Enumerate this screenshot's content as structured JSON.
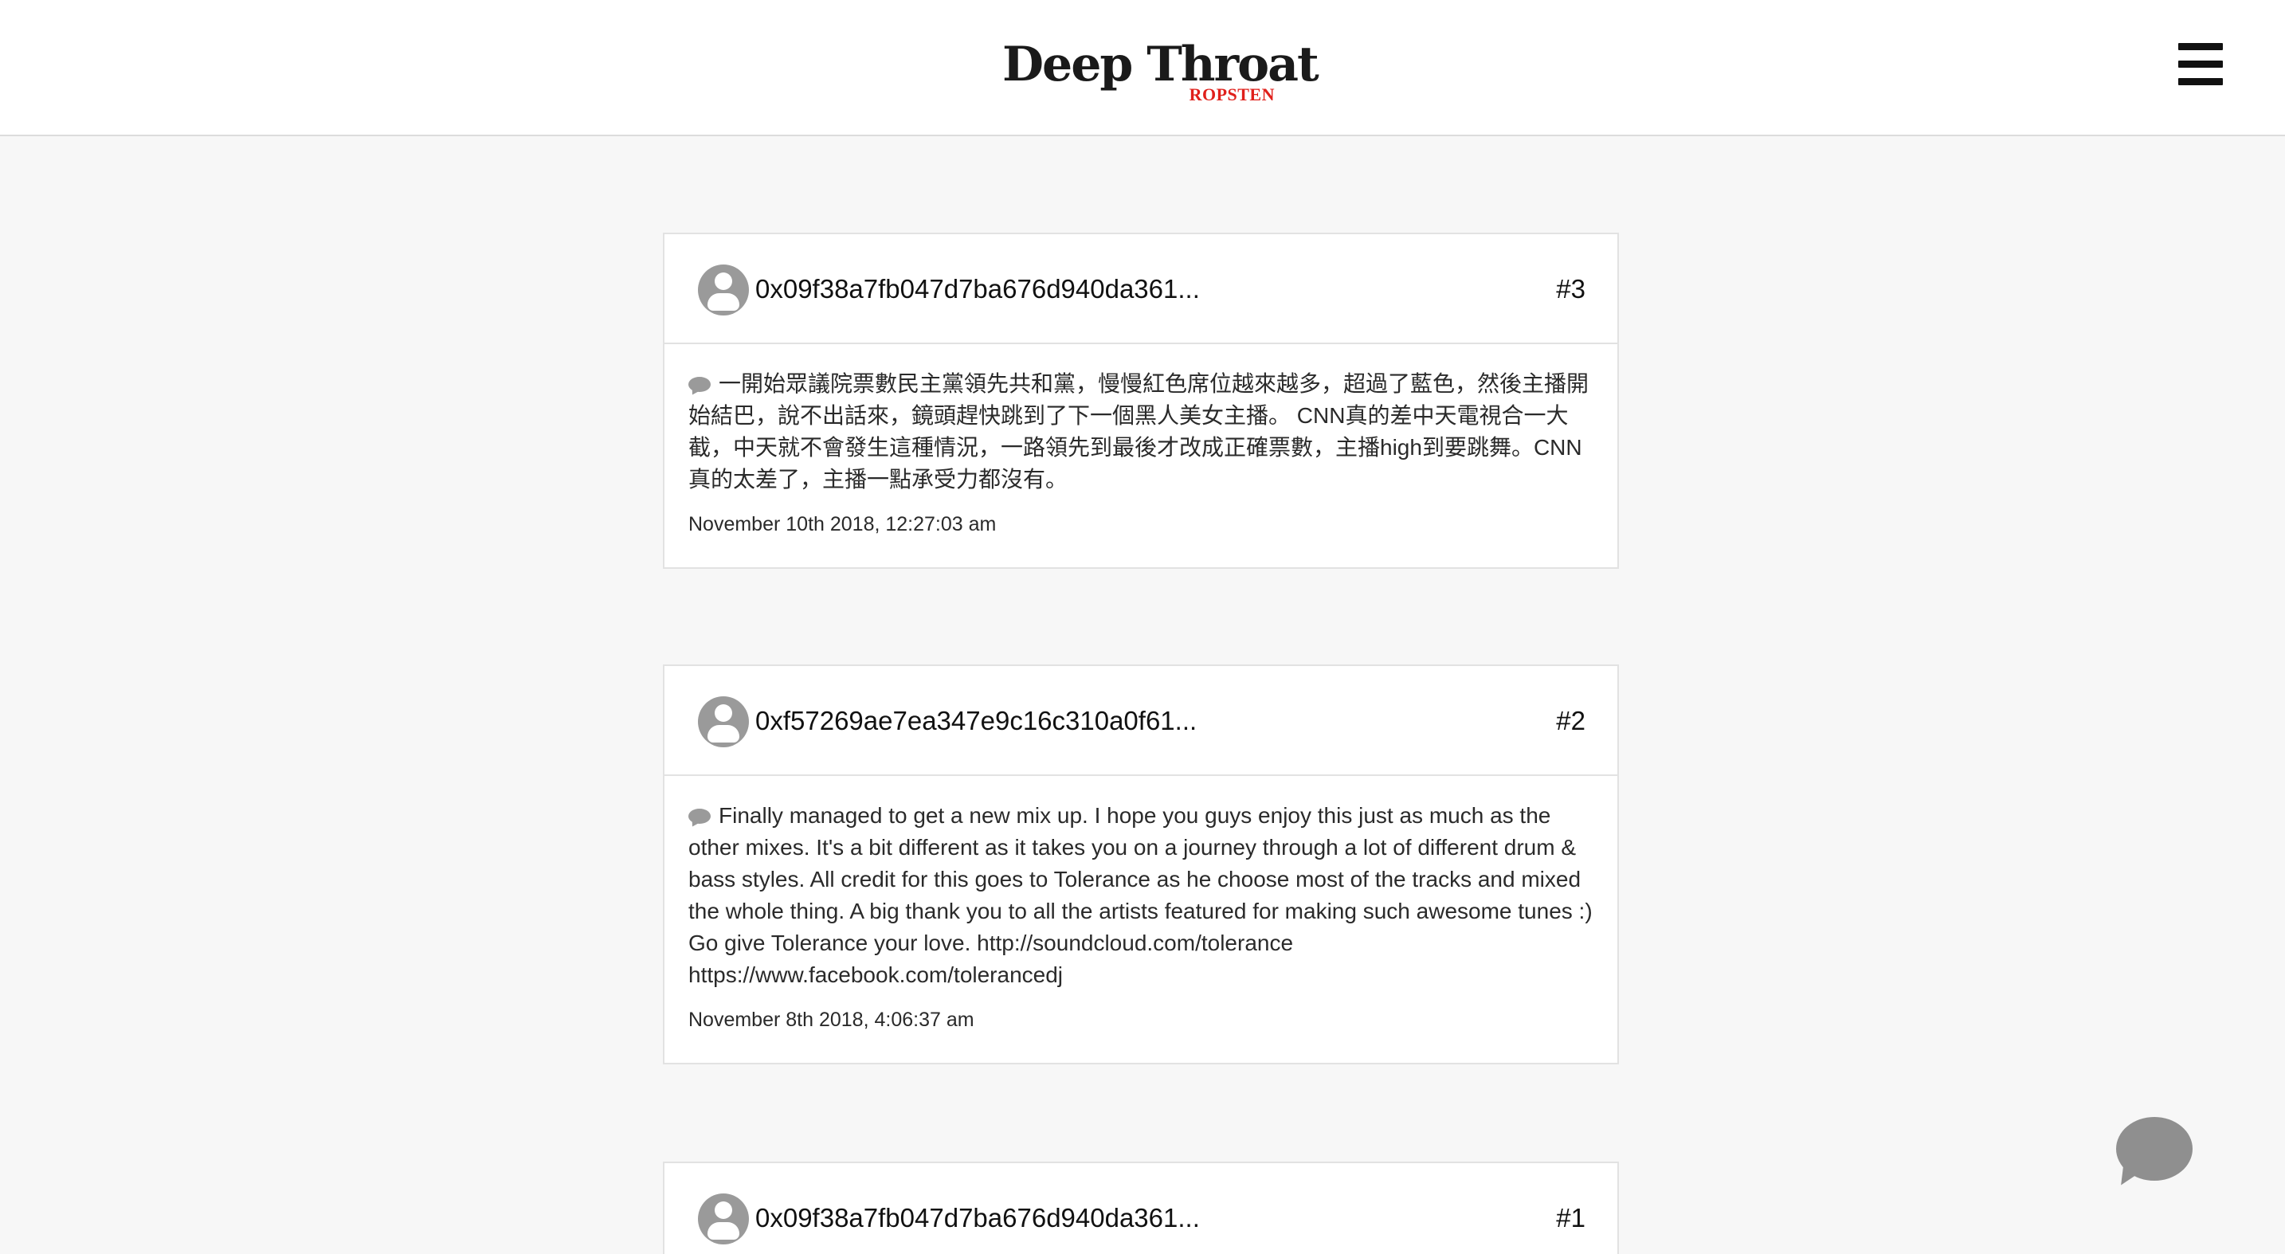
{
  "header": {
    "brand_title": "Deep Throat",
    "brand_subtitle": "ROPSTEN",
    "menu_icon": "hamburger-menu-icon"
  },
  "posts": [
    {
      "author": "0x09f38a7fb047d7ba676d940da361...",
      "number": "#3",
      "message": "一開始眾議院票數民主黨領先共和黨，慢慢紅色席位越來越多，超過了藍色，然後主播開始結巴，說不出話來，鏡頭趕快跳到了下一個黑人美女主播。 CNN真的差中天電視合一大截，中天就不會發生這種情況，一路領先到最後才改成正確票數，主播high到要跳舞。CNN真的太差了，主播一點承受力都沒有。",
      "timestamp": "November 10th 2018, 12:27:03 am"
    },
    {
      "author": "0xf57269ae7ea347e9c16c310a0f61...",
      "number": "#2",
      "message": "Finally managed to get a new mix up. I hope you guys enjoy this just as much as the other mixes. It's a bit different as it takes you on a journey through a lot of different drum & bass styles. All credit for this goes to Tolerance as he choose most of the tracks and mixed the whole thing. A big thank you to all the artists featured for making such awesome tunes :) Go give Tolerance your love. http://soundcloud.com/tolerance https://www.facebook.com/tolerancedj",
      "timestamp": "November 8th 2018, 4:06:37 am"
    },
    {
      "author": "0x09f38a7fb047d7ba676d940da361...",
      "number": "#1"
    }
  ],
  "icons": {
    "avatar": "user-avatar-icon",
    "comment": "comment-bubble-icon",
    "fab": "chat-bubble-icon"
  }
}
